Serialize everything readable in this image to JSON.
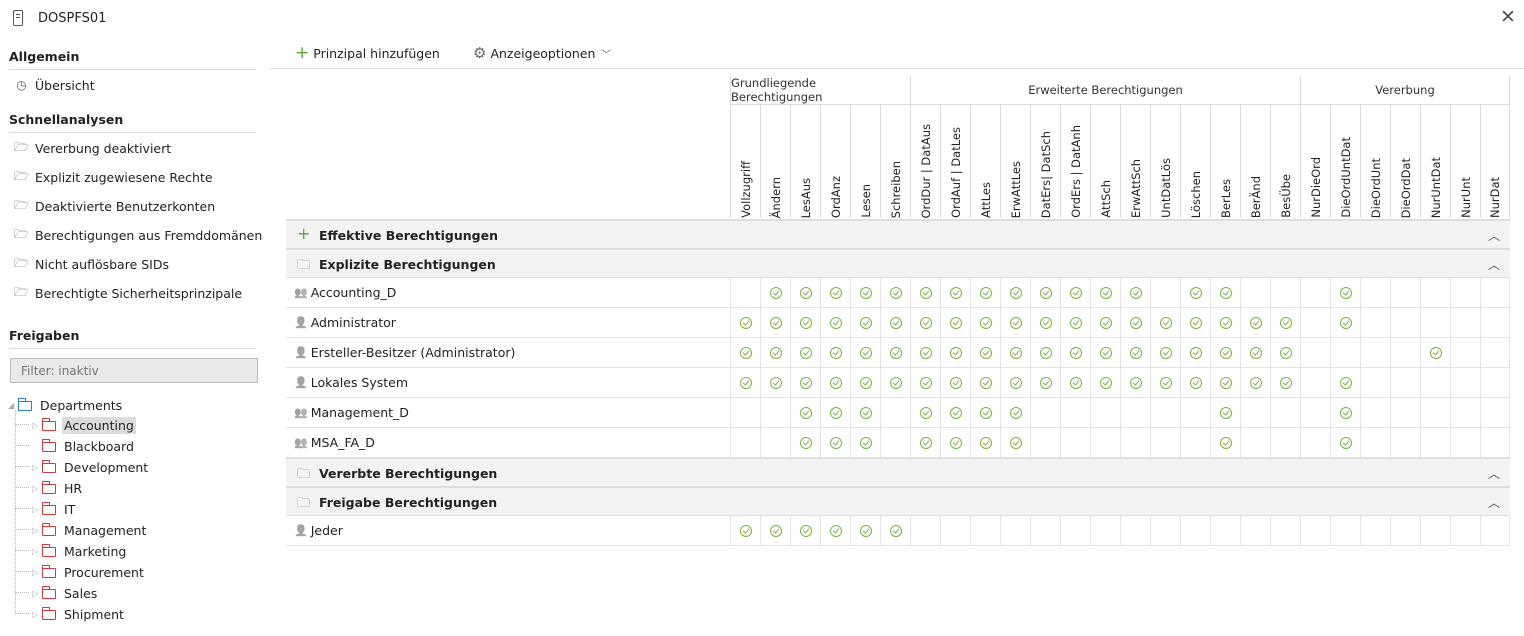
{
  "window": {
    "title": "DOSPFS01",
    "close_icon": "close-icon"
  },
  "sidebar": {
    "general_heading": "Allgemein",
    "general_items": [
      {
        "label": "Übersicht",
        "icon": "gauge-icon"
      }
    ],
    "quick_heading": "Schnellanalysen",
    "quick_items": [
      {
        "label": "Vererbung deaktiviert",
        "icon": "folder-open-icon"
      },
      {
        "label": "Explizit zugewiesene Rechte",
        "icon": "folder-open-icon"
      },
      {
        "label": "Deaktivierte Benutzerkonten",
        "icon": "folder-open-icon"
      },
      {
        "label": "Berechtigungen aus Fremddomänen",
        "icon": "folder-open-icon"
      },
      {
        "label": "Nicht auflösbare SIDs",
        "icon": "folder-open-icon"
      },
      {
        "label": "Berechtigte Sicherheitsprinzipale",
        "icon": "folder-open-icon"
      }
    ],
    "shares_heading": "Freigaben",
    "filter_placeholder": "Filter: inaktiv",
    "tree": {
      "root": "Departments",
      "children": [
        "Accounting",
        "Blackboard",
        "Development",
        "HR",
        "IT",
        "Management",
        "Marketing",
        "Procurement",
        "Sales",
        "Shipment"
      ],
      "selected": "Accounting"
    }
  },
  "toolbar": {
    "add_principal": "Prinzipal hinzufügen",
    "display_options": "Anzeigeoptionen"
  },
  "groups": [
    {
      "label": "Grundliegende Berechtigungen",
      "span": 6
    },
    {
      "label": "Erweiterte Berechtigungen",
      "span": 13
    },
    {
      "label": "Vererbung",
      "span": 7
    }
  ],
  "columns": [
    "Vollzugriff",
    "Ändern",
    "LesAus",
    "OrdAnz",
    "Lesen",
    "Schreiben",
    "OrdDur | DatAus",
    "OrdAuf | DatLes",
    "AttLes",
    "ErwAttLes",
    "DatErs| DatSch",
    "OrdErs | DatAnh",
    "AttSch",
    "ErwAttSch",
    "UntDatLös",
    "Löschen",
    "BerLes",
    "BerÄnd",
    "BesÜbe",
    "NurDieOrd",
    "DieOrdUntDat",
    "DieOrdUnt",
    "DieOrdDat",
    "NurUntDat",
    "NurUnt",
    "NurDat"
  ],
  "sections": [
    {
      "label": "Effektive Berechtigungen",
      "icon": "plus-icon",
      "rows": []
    },
    {
      "label": "Explizite Berechtigungen",
      "icon": "folder-icon",
      "rows": [
        {
          "name": "Accounting_D",
          "icon": "group-icon",
          "checks": [
            0,
            1,
            1,
            1,
            1,
            1,
            1,
            1,
            1,
            1,
            1,
            1,
            1,
            1,
            0,
            1,
            1,
            0,
            0,
            0,
            1,
            0,
            0,
            0,
            0,
            0
          ]
        },
        {
          "name": "Administrator",
          "icon": "user-icon",
          "checks": [
            1,
            1,
            1,
            1,
            1,
            1,
            1,
            1,
            1,
            1,
            1,
            1,
            1,
            1,
            1,
            1,
            1,
            1,
            1,
            0,
            1,
            0,
            0,
            0,
            0,
            0
          ]
        },
        {
          "name": "Ersteller-Besitzer (Administrator)",
          "icon": "user-icon",
          "checks": [
            1,
            1,
            1,
            1,
            1,
            1,
            1,
            1,
            1,
            1,
            1,
            1,
            1,
            1,
            1,
            1,
            1,
            1,
            1,
            0,
            0,
            0,
            0,
            1,
            0,
            0
          ]
        },
        {
          "name": "Lokales System",
          "icon": "user-icon",
          "checks": [
            1,
            1,
            1,
            1,
            1,
            1,
            1,
            1,
            1,
            1,
            1,
            1,
            1,
            1,
            1,
            1,
            1,
            1,
            1,
            0,
            1,
            0,
            0,
            0,
            0,
            0
          ]
        },
        {
          "name": "Management_D",
          "icon": "group-icon",
          "checks": [
            0,
            0,
            1,
            1,
            1,
            0,
            1,
            1,
            1,
            1,
            0,
            0,
            0,
            0,
            0,
            0,
            1,
            0,
            0,
            0,
            1,
            0,
            0,
            0,
            0,
            0
          ]
        },
        {
          "name": "MSA_FA_D",
          "icon": "group-icon",
          "checks": [
            0,
            0,
            1,
            1,
            1,
            0,
            1,
            1,
            1,
            1,
            0,
            0,
            0,
            0,
            0,
            0,
            1,
            0,
            0,
            0,
            1,
            0,
            0,
            0,
            0,
            0
          ]
        }
      ]
    },
    {
      "label": "Vererbte Berechtigungen",
      "icon": "folder-icon",
      "rows": []
    },
    {
      "label": "Freigabe Berechtigungen",
      "icon": "folder-icon",
      "rows": [
        {
          "name": "Jeder",
          "icon": "user-icon",
          "checks": [
            1,
            1,
            1,
            1,
            1,
            1,
            0,
            0,
            0,
            0,
            0,
            0,
            0,
            0,
            0,
            0,
            0,
            0,
            0,
            0,
            0,
            0,
            0,
            0,
            0,
            0
          ]
        }
      ]
    }
  ]
}
